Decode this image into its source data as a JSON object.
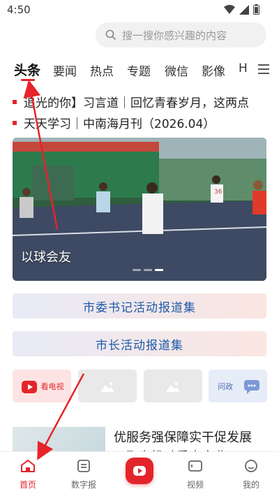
{
  "status": {
    "time": "4:50"
  },
  "search": {
    "placeholder": "搜一搜你感兴趣的内容"
  },
  "tabs": [
    {
      "label": "头条",
      "active": true
    },
    {
      "label": "要闻"
    },
    {
      "label": "热点"
    },
    {
      "label": "专题"
    },
    {
      "label": "微信"
    },
    {
      "label": "影像"
    },
    {
      "label": "H"
    }
  ],
  "headlines": [
    "追光的你】习言道｜回忆青春岁月，这两点",
    "天天学习｜中南海月刊（2026.04）"
  ],
  "banner": {
    "caption": "以球会友",
    "jersey_number": "36"
  },
  "reports": [
    "市委书记活动报道集",
    "市长活动报道集"
  ],
  "tiles": [
    {
      "label": "看电视",
      "icon": "tv-play-icon"
    },
    {
      "label": "",
      "icon": "image-placeholder-icon"
    },
    {
      "label": "",
      "icon": "image-placeholder-icon"
    },
    {
      "label": "问政",
      "icon": "chat-bubble-icon"
    }
  ],
  "news": {
    "title": "优服务强保障实干促发展 …聚力推动重大产业"
  },
  "bottom_nav": [
    {
      "label": "首页",
      "icon": "home-icon",
      "active": true
    },
    {
      "label": "数字报",
      "icon": "newspaper-icon"
    },
    {
      "label": "",
      "icon": "play-center-icon"
    },
    {
      "label": "视频",
      "icon": "video-icon"
    },
    {
      "label": "我的",
      "icon": "profile-icon"
    }
  ],
  "colors": {
    "accent": "#e3252b",
    "report_text": "#1e5aa8",
    "annotation_arrow": "#e8232a"
  }
}
